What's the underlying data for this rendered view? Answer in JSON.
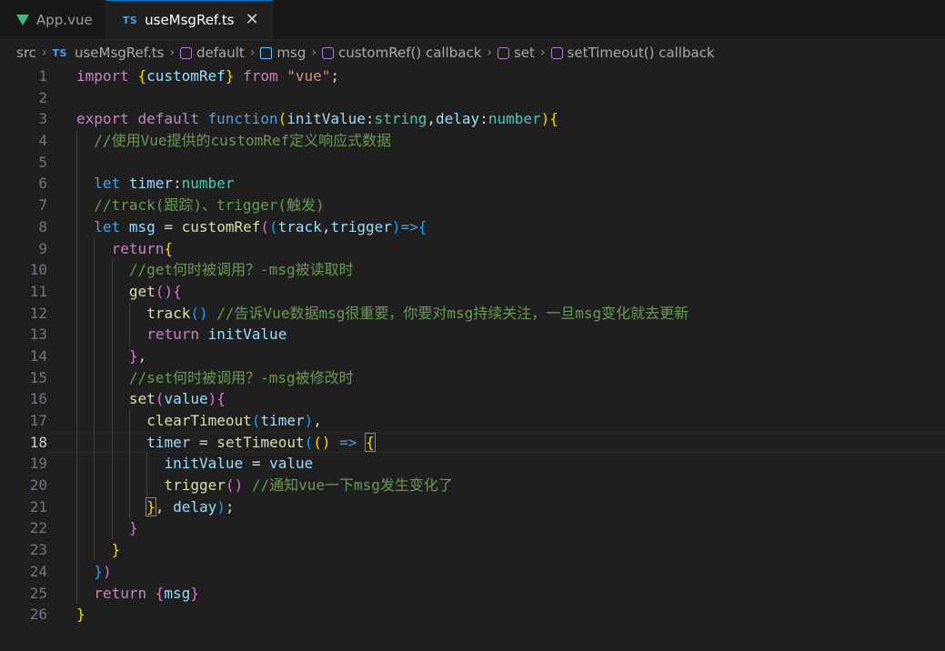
{
  "tabs": [
    {
      "label": "App.vue",
      "icon": "vue-icon",
      "active": false
    },
    {
      "label": "useMsgRef.ts",
      "icon": "ts-icon",
      "active": true
    }
  ],
  "tab_badge": "TS",
  "breadcrumb": [
    {
      "label": "src",
      "icon": ""
    },
    {
      "label": "useMsgRef.ts",
      "icon": "ts-icon"
    },
    {
      "label": "default",
      "icon": "cube-icon"
    },
    {
      "label": "msg",
      "icon": "variable-icon"
    },
    {
      "label": "customRef() callback",
      "icon": "cube-icon"
    },
    {
      "label": "set",
      "icon": "cube-icon"
    },
    {
      "label": "setTimeout() callback",
      "icon": "cube-icon"
    }
  ],
  "active_line": 18,
  "colors": {
    "accent": "#0078d4",
    "background": "#1f1f1f",
    "vue": "#41b883",
    "ts": "#4d9df0"
  },
  "lines": [
    {
      "n": 1,
      "indent": 0,
      "tokens": [
        [
          "kwc",
          "import"
        ],
        [
          "pl",
          " "
        ],
        [
          "b1",
          "{"
        ],
        [
          "id",
          "customRef"
        ],
        [
          "b1",
          "}"
        ],
        [
          "pl",
          " "
        ],
        [
          "kwc",
          "from"
        ],
        [
          "pl",
          " "
        ],
        [
          "str",
          "\"vue\""
        ],
        [
          "pl",
          ";"
        ]
      ]
    },
    {
      "n": 2,
      "indent": 0,
      "tokens": []
    },
    {
      "n": 3,
      "indent": 0,
      "tokens": [
        [
          "kwc",
          "export"
        ],
        [
          "pl",
          " "
        ],
        [
          "kwc",
          "default"
        ],
        [
          "pl",
          " "
        ],
        [
          "kw",
          "function"
        ],
        [
          "b1",
          "("
        ],
        [
          "id",
          "initValue"
        ],
        [
          "pl",
          ":"
        ],
        [
          "ty",
          "string"
        ],
        [
          "pl",
          ","
        ],
        [
          "id",
          "delay"
        ],
        [
          "pl",
          ":"
        ],
        [
          "ty",
          "number"
        ],
        [
          "b1",
          ")"
        ],
        [
          "b1",
          "{"
        ]
      ]
    },
    {
      "n": 4,
      "indent": 1,
      "tokens": [
        [
          "cm",
          "//使用Vue提供的customRef定义响应式数据"
        ]
      ]
    },
    {
      "n": 5,
      "indent": 1,
      "tokens": []
    },
    {
      "n": 6,
      "indent": 1,
      "tokens": [
        [
          "kw",
          "let"
        ],
        [
          "pl",
          " "
        ],
        [
          "id",
          "timer"
        ],
        [
          "pl",
          ":"
        ],
        [
          "ty",
          "number"
        ]
      ]
    },
    {
      "n": 7,
      "indent": 1,
      "tokens": [
        [
          "cm",
          "//track(跟踪)、trigger(触发)"
        ]
      ]
    },
    {
      "n": 8,
      "indent": 1,
      "tokens": [
        [
          "kw",
          "let"
        ],
        [
          "pl",
          " "
        ],
        [
          "id",
          "msg"
        ],
        [
          "pl",
          " = "
        ],
        [
          "fn",
          "customRef"
        ],
        [
          "b2",
          "("
        ],
        [
          "b3",
          "("
        ],
        [
          "id",
          "track"
        ],
        [
          "pl",
          ","
        ],
        [
          "id",
          "trigger"
        ],
        [
          "b3",
          ")"
        ],
        [
          "kw",
          "=>"
        ],
        [
          "b3",
          "{"
        ]
      ]
    },
    {
      "n": 9,
      "indent": 2,
      "tokens": [
        [
          "kwc",
          "return"
        ],
        [
          "b1",
          "{"
        ]
      ]
    },
    {
      "n": 10,
      "indent": 3,
      "tokens": [
        [
          "cm",
          "//get何时被调用？-msg被读取时"
        ]
      ]
    },
    {
      "n": 11,
      "indent": 3,
      "tokens": [
        [
          "fn",
          "get"
        ],
        [
          "b2",
          "("
        ],
        [
          "b2",
          ")"
        ],
        [
          "b2",
          "{"
        ]
      ]
    },
    {
      "n": 12,
      "indent": 4,
      "tokens": [
        [
          "fn",
          "track"
        ],
        [
          "b3",
          "("
        ],
        [
          "b3",
          ")"
        ],
        [
          "pl",
          " "
        ],
        [
          "cm",
          "//告诉Vue数据msg很重要，你要对msg持续关注，一旦msg变化就去更新"
        ]
      ]
    },
    {
      "n": 13,
      "indent": 4,
      "tokens": [
        [
          "kwc",
          "return"
        ],
        [
          "pl",
          " "
        ],
        [
          "id",
          "initValue"
        ]
      ]
    },
    {
      "n": 14,
      "indent": 3,
      "tokens": [
        [
          "b2",
          "}"
        ],
        [
          "pl",
          ","
        ]
      ]
    },
    {
      "n": 15,
      "indent": 3,
      "tokens": [
        [
          "cm",
          "//set何时被调用？-msg被修改时"
        ]
      ]
    },
    {
      "n": 16,
      "indent": 3,
      "tokens": [
        [
          "fn",
          "set"
        ],
        [
          "b2",
          "("
        ],
        [
          "id",
          "value"
        ],
        [
          "b2",
          ")"
        ],
        [
          "b2",
          "{"
        ]
      ]
    },
    {
      "n": 17,
      "indent": 4,
      "tokens": [
        [
          "fn",
          "clearTimeout"
        ],
        [
          "b3",
          "("
        ],
        [
          "id",
          "timer"
        ],
        [
          "b3",
          ")"
        ],
        [
          "pl",
          ","
        ]
      ]
    },
    {
      "n": 18,
      "indent": 4,
      "tokens": [
        [
          "id",
          "timer"
        ],
        [
          "pl",
          " = "
        ],
        [
          "fn",
          "setTimeout"
        ],
        [
          "b3",
          "("
        ],
        [
          "b1",
          "("
        ],
        [
          "b1",
          ")"
        ],
        [
          "pl",
          " "
        ],
        [
          "kw",
          "=>"
        ],
        [
          "pl",
          " "
        ],
        [
          "b1",
          "{"
        ]
      ]
    },
    {
      "n": 19,
      "indent": 5,
      "tokens": [
        [
          "id",
          "initValue"
        ],
        [
          "pl",
          " = "
        ],
        [
          "id",
          "value"
        ]
      ]
    },
    {
      "n": 20,
      "indent": 5,
      "tokens": [
        [
          "fn",
          "trigger"
        ],
        [
          "b2",
          "("
        ],
        [
          "b2",
          ")"
        ],
        [
          "pl",
          " "
        ],
        [
          "cm",
          "//通知vue一下msg发生变化了"
        ]
      ]
    },
    {
      "n": 21,
      "indent": 4,
      "tokens": [
        [
          "b1",
          "}"
        ],
        [
          "pl",
          ", "
        ],
        [
          "id",
          "delay"
        ],
        [
          "b3",
          ")"
        ],
        [
          "pl",
          ";"
        ]
      ]
    },
    {
      "n": 22,
      "indent": 3,
      "tokens": [
        [
          "b2",
          "}"
        ]
      ]
    },
    {
      "n": 23,
      "indent": 2,
      "tokens": [
        [
          "b1",
          "}"
        ]
      ]
    },
    {
      "n": 24,
      "indent": 1,
      "tokens": [
        [
          "b3",
          "}"
        ],
        [
          "b2",
          ")"
        ]
      ]
    },
    {
      "n": 25,
      "indent": 1,
      "tokens": [
        [
          "kwc",
          "return"
        ],
        [
          "pl",
          " "
        ],
        [
          "b2",
          "{"
        ],
        [
          "id",
          "msg"
        ],
        [
          "b2",
          "}"
        ]
      ]
    },
    {
      "n": 26,
      "indent": 0,
      "tokens": [
        [
          "b1",
          "}"
        ]
      ]
    }
  ]
}
